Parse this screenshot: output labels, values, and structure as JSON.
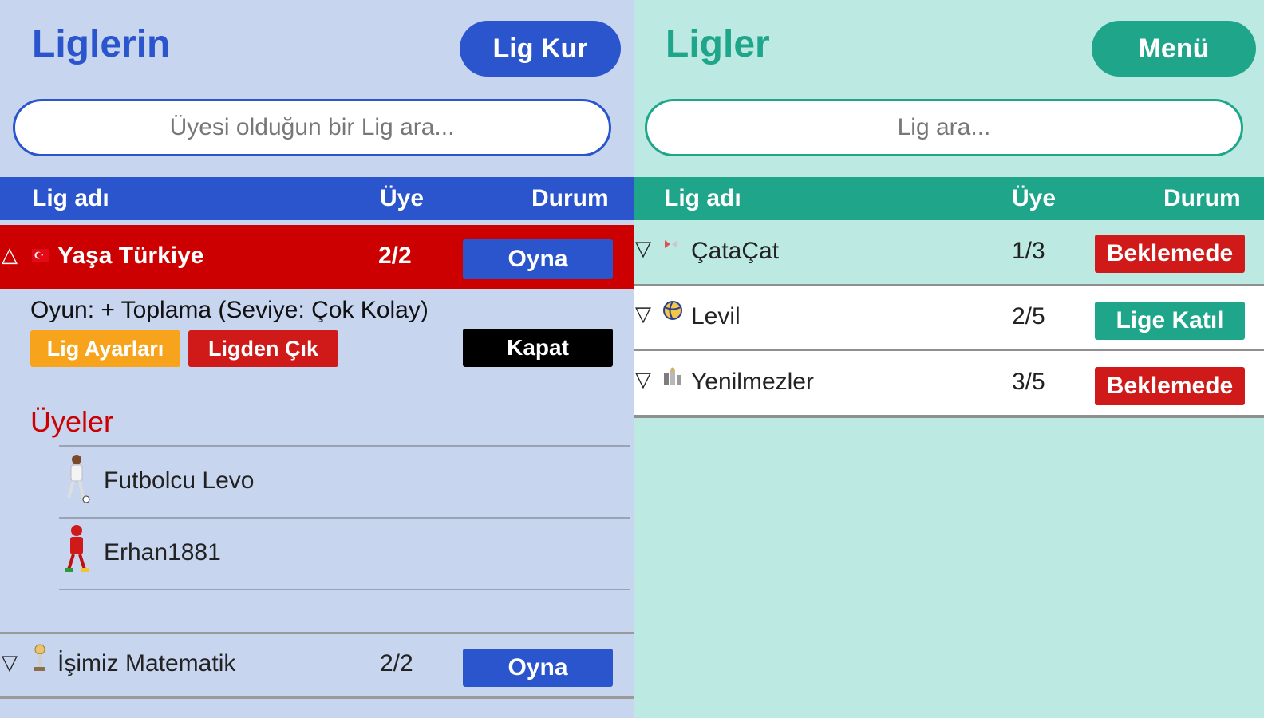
{
  "left": {
    "title": "Liglerin",
    "create_button": "Lig Kur",
    "search_placeholder": "Üyesi olduğun bir Lig ara...",
    "headers": {
      "name": "Lig adı",
      "members": "Üye",
      "status": "Durum"
    },
    "expanded_league": {
      "name": "Yaşa Türkiye",
      "members": "2/2",
      "action": "Oyna",
      "game_info": "Oyun: + Toplama (Seviye: Çok Kolay)",
      "settings_button": "Lig Ayarları",
      "leave_button": "Ligden Çık",
      "close_button": "Kapat",
      "members_title": "Üyeler",
      "member_list": [
        {
          "name": "Futbolcu Levo",
          "avatar": "footballer-avatar"
        },
        {
          "name": "Erhan1881",
          "avatar": "red-player-avatar"
        }
      ]
    },
    "other_leagues": [
      {
        "name": "İşimiz Matematik",
        "members": "2/2",
        "action": "Oyna"
      }
    ]
  },
  "right": {
    "title": "Ligler",
    "menu_button": "Menü",
    "search_placeholder": "Lig ara...",
    "headers": {
      "name": "Lig adı",
      "members": "Üye",
      "status": "Durum"
    },
    "leagues": [
      {
        "name": "ÇataÇat",
        "members": "1/3",
        "status": "Beklemede",
        "status_color": "#d01a1a"
      },
      {
        "name": "Levil",
        "members": "2/5",
        "status": "Lige Katıl",
        "status_color": "#1fa68a"
      },
      {
        "name": "Yenilmezler",
        "members": "3/5",
        "status": "Beklemede",
        "status_color": "#d01a1a"
      }
    ]
  },
  "colors": {
    "left_accent": "#2a55cc",
    "right_accent": "#1fa68a",
    "expanded_row": "#cc0000",
    "danger": "#d01a1a",
    "warning": "#f7a41c"
  }
}
